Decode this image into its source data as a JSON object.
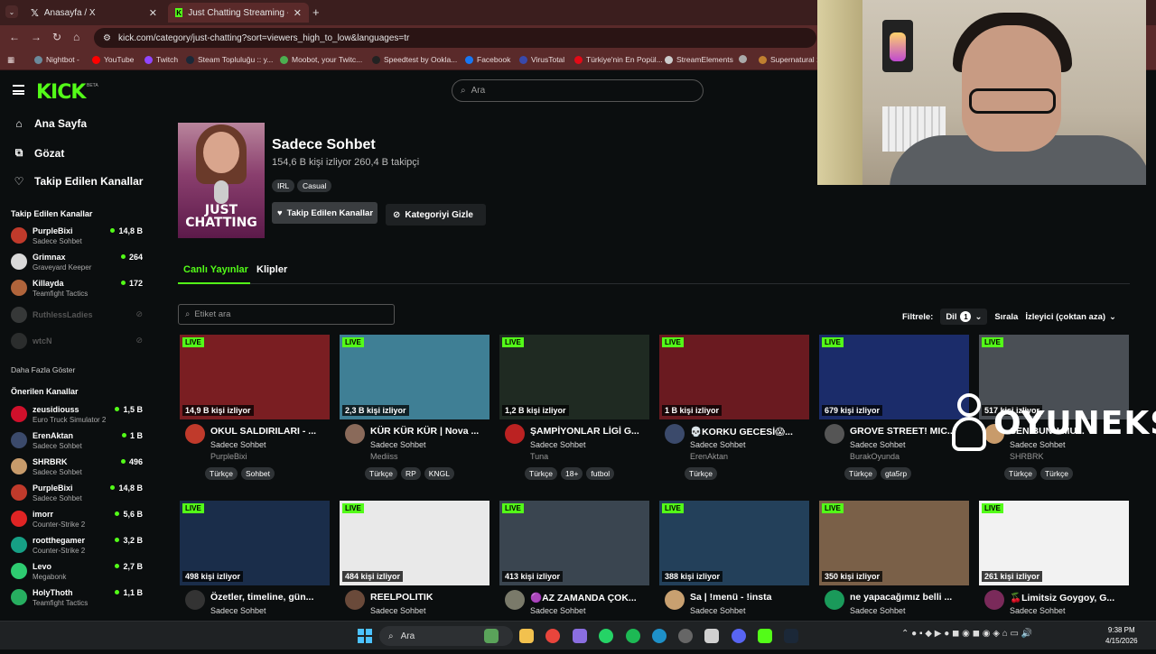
{
  "browser": {
    "tabs": [
      {
        "label": "Anasayfa / X"
      },
      {
        "label": "Just Chatting Streaming - Live"
      }
    ],
    "url": "kick.com/category/just-chatting?sort=viewers_high_to_low&languages=tr",
    "bookmarks": [
      "Nightbot -",
      "YouTube",
      "Twitch",
      "Steam Topluluğu :: y...",
      "Moobot, your Twitc...",
      "Speedtest by Ookla...",
      "Facebook",
      "VirusTotal",
      "Türkiye'nin En Popül...",
      "StreamElements",
      "",
      "Supernatural 1"
    ]
  },
  "header": {
    "logo": "KICK",
    "beta": "BETA",
    "search_placeholder": "Ara"
  },
  "sidebar": {
    "nav": [
      "Ana Sayfa",
      "Gözat",
      "Takip Edilen Kanallar"
    ],
    "followed_heading": "Takip Edilen Kanallar",
    "followed": [
      {
        "name": "PurpleBixi",
        "game": "Sadece Sohbet",
        "viewers": "14,8 B",
        "color": "#c03a2b"
      },
      {
        "name": "Grimnax",
        "game": "Graveyard Keeper",
        "viewers": "264",
        "color": "#d9d9d9"
      },
      {
        "name": "Killayda",
        "game": "Teamfight Tactics",
        "viewers": "172",
        "color": "#b0643b"
      }
    ],
    "offline": [
      {
        "name": "RuthlessLadies",
        "color": "#888888"
      },
      {
        "name": "wtcN",
        "color": "#666666"
      }
    ],
    "show_more": "Daha Fazla Göster",
    "recommended_heading": "Önerilen Kanallar",
    "recommended": [
      {
        "name": "zeusidiouss",
        "game": "Euro Truck Simulator 2",
        "viewers": "1,5 B",
        "color": "#d0102b"
      },
      {
        "name": "ErenAktan",
        "game": "Sadece Sohbet",
        "viewers": "1 B",
        "color": "#3b4a6b"
      },
      {
        "name": "SHRBRK",
        "game": "Sadece Sohbet",
        "viewers": "496",
        "color": "#c89b6b"
      },
      {
        "name": "PurpleBixi",
        "game": "Sadece Sohbet",
        "viewers": "14,8 B",
        "color": "#c03a2b"
      },
      {
        "name": "imorr",
        "game": "Counter-Strike 2",
        "viewers": "5,6 B",
        "color": "#e02424"
      },
      {
        "name": "rootthegamer",
        "game": "Counter-Strike 2",
        "viewers": "3,2 B",
        "color": "#16a085"
      },
      {
        "name": "Levo",
        "game": "Megabonk",
        "viewers": "2,7 B",
        "color": "#2ecc71"
      },
      {
        "name": "HolyThoth",
        "game": "Teamfight Tactics",
        "viewers": "1,1 B",
        "color": "#27ae60"
      }
    ]
  },
  "category": {
    "image_text": "JUST CHATTING",
    "title": "Sadece Sohbet",
    "stats": "154,6 B kişi izliyor  260,4 B takipçi",
    "tags": [
      "IRL",
      "Casual"
    ],
    "follow_label": "Takip Edilen Kanallar",
    "hide_label": "Kategoriyi Gizle"
  },
  "tabs": {
    "live": "Canlı Yayınlar",
    "clips": "Klipler"
  },
  "filters": {
    "tag_search_placeholder": "Etiket ara",
    "filter_label": "Filtrele:",
    "language_label": "Dil",
    "language_count": "1",
    "sort_label": "Sırala",
    "sort_value": "İzleyici (çoktan aza)"
  },
  "live_badge": "LIVE",
  "streams": [
    {
      "viewers": "14,9 B kişi izliyor",
      "title": "OKUL SALDIRILARI - ...",
      "category": "Sadece Sohbet",
      "user": "PurpleBixi",
      "tags": [
        "Türkçe",
        "Sohbet"
      ],
      "thumb": "#7a1e22",
      "avatar": "#c03a2b"
    },
    {
      "viewers": "2,3 B kişi izliyor",
      "title": "KÜR KÜR KÜR | Nova ...",
      "category": "Sadece Sohbet",
      "user": "Mediiss",
      "tags": [
        "Türkçe",
        "RP",
        "KNGL"
      ],
      "thumb": "#3f7f95",
      "avatar": "#8a6a5a"
    },
    {
      "viewers": "1,2 B kişi izliyor",
      "title": "ŞAMPİYONLAR LİGİ G...",
      "category": "Sadece Sohbet",
      "user": "Tuna",
      "tags": [
        "Türkçe",
        "18+",
        "futbol"
      ],
      "thumb": "#1f2a22",
      "avatar": "#b22"
    },
    {
      "viewers": "1 B kişi izliyor",
      "title": "💀KORKU GECESİ😱...",
      "category": "Sadece Sohbet",
      "user": "ErenAktan",
      "tags": [
        "Türkçe"
      ],
      "thumb": "#6a1a20",
      "avatar": "#3b4a6b"
    },
    {
      "viewers": "679 kişi izliyor",
      "title": "GROVE STREET! MIC...",
      "category": "Sadece Sohbet",
      "user": "BurakOyunda",
      "tags": [
        "Türkçe",
        "gta5rp"
      ],
      "thumb": "#1b2c6a",
      "avatar": "#555"
    },
    {
      "viewers": "517 kişi izliyor",
      "title": "SEN BUNU MU...",
      "category": "Sadece Sohbet",
      "user": "SHRBRK",
      "tags": [
        "Türkçe",
        "Türkçe"
      ],
      "thumb": "#4a4f55",
      "avatar": "#c89b6b"
    },
    {
      "viewers": "498 kişi izliyor",
      "title": "Özetler, timeline, gün...",
      "category": "Sadece Sohbet",
      "user": "",
      "tags": [],
      "thumb": "#1a2d4a",
      "avatar": "#333"
    },
    {
      "viewers": "484 kişi izliyor",
      "title": "REELPOLITIK",
      "category": "Sadece Sohbet",
      "user": "",
      "tags": [],
      "thumb": "#e9e9e9",
      "avatar": "#6a4a3a"
    },
    {
      "viewers": "413 kişi izliyor",
      "title": "🟣AZ ZAMANDA ÇOK...",
      "category": "Sadece Sohbet",
      "user": "",
      "tags": [],
      "thumb": "#3a4550",
      "avatar": "#7a7a6a"
    },
    {
      "viewers": "388 kişi izliyor",
      "title": "Sa | !menü - !insta",
      "category": "Sadece Sohbet",
      "user": "",
      "tags": [],
      "thumb": "#23405a",
      "avatar": "#c8a070"
    },
    {
      "viewers": "350 kişi izliyor",
      "title": "ne yapacağımız belli ...",
      "category": "Sadece Sohbet",
      "user": "",
      "tags": [],
      "thumb": "#7a6048",
      "avatar": "#1a9a5a"
    },
    {
      "viewers": "261 kişi izliyor",
      "title": "🍒Limitsiz Goygoy, G...",
      "category": "Sadece Sohbet",
      "user": "",
      "tags": [],
      "thumb": "#f2f2f2",
      "avatar": "#7a2a5a"
    }
  ],
  "watermark": "OYUNEKS",
  "taskbar": {
    "search_placeholder": "Ara",
    "time": "9:38 PM",
    "date": "4/15/2026"
  }
}
